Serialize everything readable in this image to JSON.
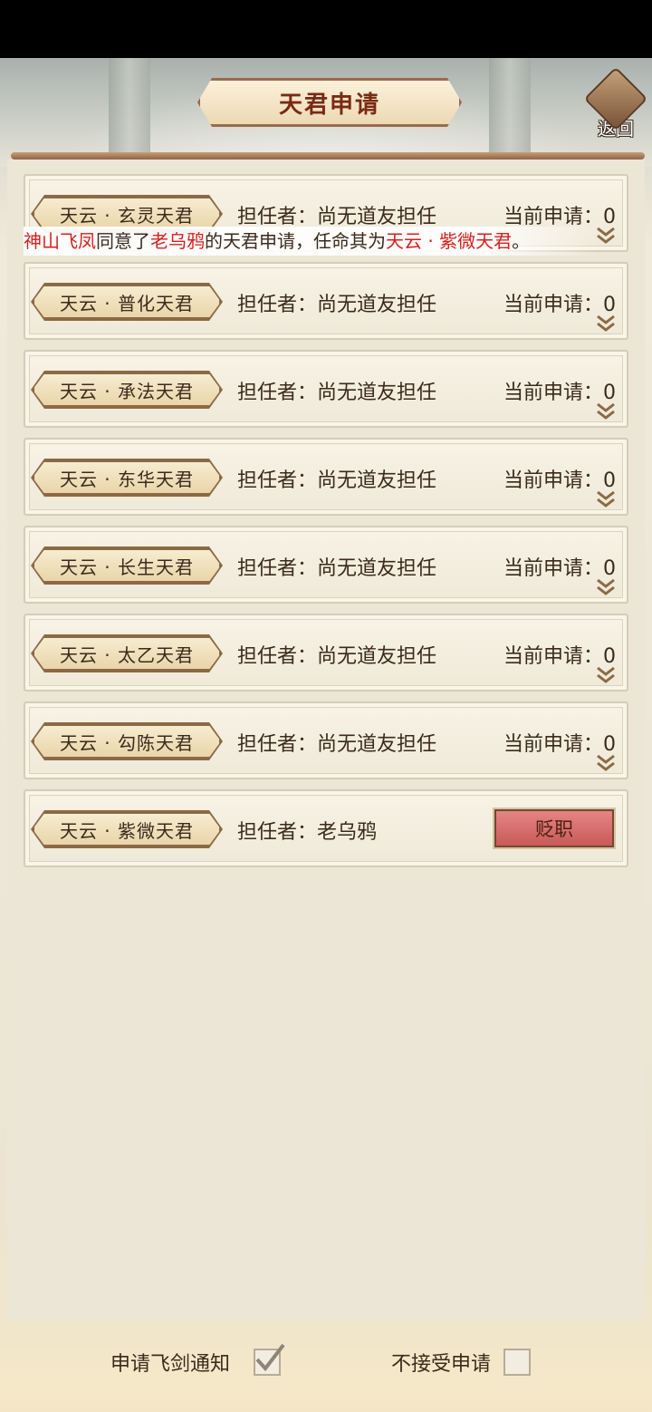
{
  "header": {
    "title": "天君申请",
    "back_label": "返回"
  },
  "notice": {
    "actor": "神山飞凤",
    "text1": "同意了",
    "target": "老乌鸦",
    "text2": "的天君申请，任命其为",
    "position": "天云 · 紫微天君",
    "text3": "。"
  },
  "rows": [
    {
      "title": "天云 · 玄灵天君",
      "holder": "担任者：尚无道友担任",
      "applications": "当前申请：0"
    },
    {
      "title": "天云 · 普化天君",
      "holder": "担任者：尚无道友担任",
      "applications": "当前申请：0"
    },
    {
      "title": "天云 · 承法天君",
      "holder": "担任者：尚无道友担任",
      "applications": "当前申请：0"
    },
    {
      "title": "天云 · 东华天君",
      "holder": "担任者：尚无道友担任",
      "applications": "当前申请：0"
    },
    {
      "title": "天云 · 长生天君",
      "holder": "担任者：尚无道友担任",
      "applications": "当前申请：0"
    },
    {
      "title": "天云 · 太乙天君",
      "holder": "担任者：尚无道友担任",
      "applications": "当前申请：0"
    },
    {
      "title": "天云 · 勾陈天君",
      "holder": "担任者：尚无道友担任",
      "applications": "当前申请：0"
    },
    {
      "title": "天云 · 紫微天君",
      "holder": "担任者：老乌鸦",
      "action_label": "贬职"
    }
  ],
  "footer": {
    "notify_label": "申请飞剑通知",
    "notify_checked": true,
    "reject_label": "不接受申请",
    "reject_checked": false
  },
  "colors": {
    "highlight_red": "#d4201c",
    "dismiss_button": "#d86e6c",
    "title_text": "#7a2a14"
  }
}
